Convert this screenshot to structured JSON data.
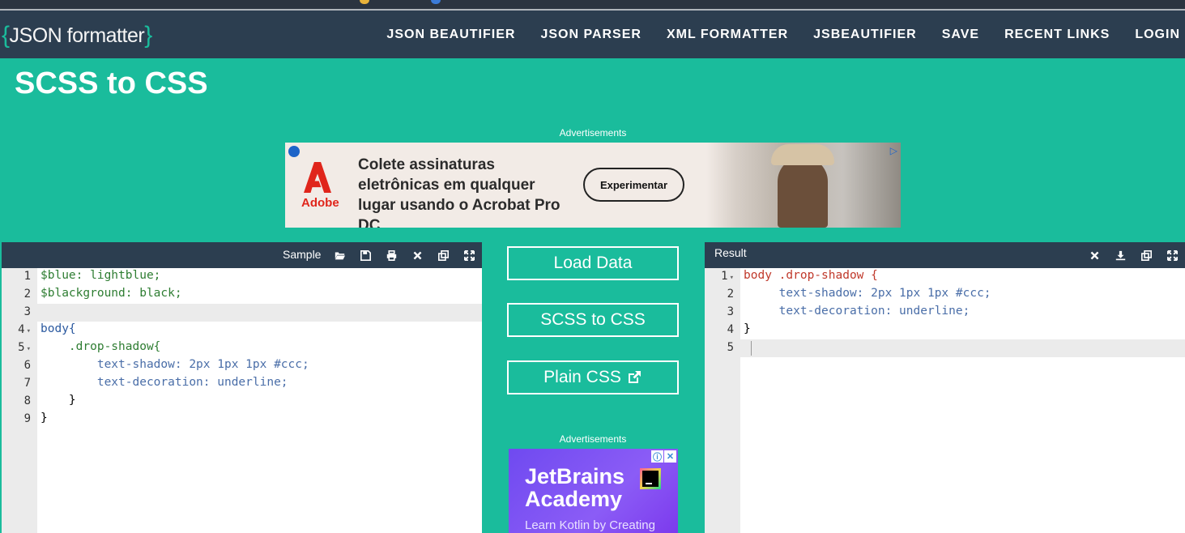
{
  "site": {
    "logo_open": "{",
    "logo_text": "JSON formatter",
    "logo_close": "}"
  },
  "nav": [
    {
      "label": "JSON BEAUTIFIER"
    },
    {
      "label": "JSON PARSER"
    },
    {
      "label": "XML FORMATTER"
    },
    {
      "label": "JSBEAUTIFIER"
    },
    {
      "label": "SAVE"
    },
    {
      "label": "RECENT LINKS"
    },
    {
      "label": "LOGIN"
    }
  ],
  "page_title": "SCSS to CSS",
  "ads_label": "Advertisements",
  "top_ad": {
    "brand": "Adobe",
    "copy": "Colete assinaturas eletrônicas em qualquer lugar usando o Acrobat Pro DC.",
    "cta": "Experimentar"
  },
  "sample_panel": {
    "title": "Sample",
    "icons": [
      "folder-open-icon",
      "save-icon",
      "print-icon",
      "clear-icon",
      "copy-icon",
      "fullscreen-icon"
    ],
    "line_numbers": [
      "1",
      "2",
      "3",
      "4",
      "5",
      "6",
      "7",
      "8",
      "9"
    ],
    "lines": [
      "$blue: lightblue;",
      "$blackground: black;",
      "",
      "body{",
      "    .drop-shadow{",
      "        text-shadow: 2px 1px 1px #ccc;",
      "        text-decoration: underline;",
      "    }",
      "}"
    ]
  },
  "result_panel": {
    "title": "Result",
    "icons": [
      "clear-icon",
      "download-icon",
      "copy-icon",
      "fullscreen-icon"
    ],
    "line_numbers": [
      "1",
      "2",
      "3",
      "4",
      "5"
    ],
    "lines": [
      "body .drop-shadow {",
      "     text-shadow: 2px 1px 1px #ccc;",
      "     text-decoration: underline;",
      "}",
      ""
    ]
  },
  "buttons": {
    "load_data": "Load Data",
    "scss_to_css": "SCSS to CSS",
    "plain_css": "Plain CSS"
  },
  "side_ad": {
    "title": "JetBrains Academy",
    "subtitle": "Learn Kotlin by Creating"
  },
  "colors": {
    "accent": "#1abc9c",
    "navbar": "#2c3e50",
    "panel_header": "#2c3e50"
  }
}
